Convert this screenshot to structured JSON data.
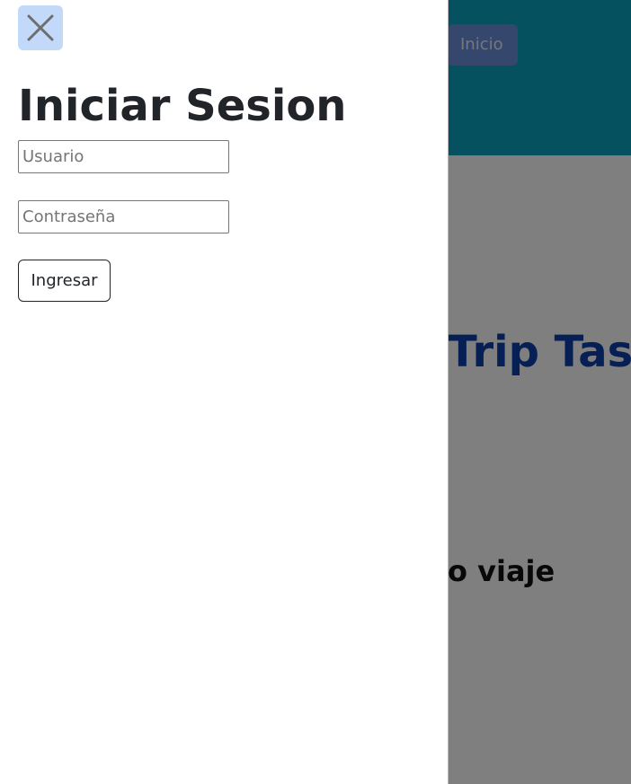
{
  "background": {
    "nav_button_label": "Inicio",
    "brand": "Trip Tastic",
    "tagline": "o viaje",
    "header_color": "#0aa2c0"
  },
  "offcanvas": {
    "close_icon": "close-icon",
    "title": "Iniciar Sesion",
    "username": {
      "value": "",
      "placeholder": "Usuario"
    },
    "password": {
      "value": "",
      "placeholder": "Contraseña"
    },
    "submit_label": "Ingresar"
  }
}
